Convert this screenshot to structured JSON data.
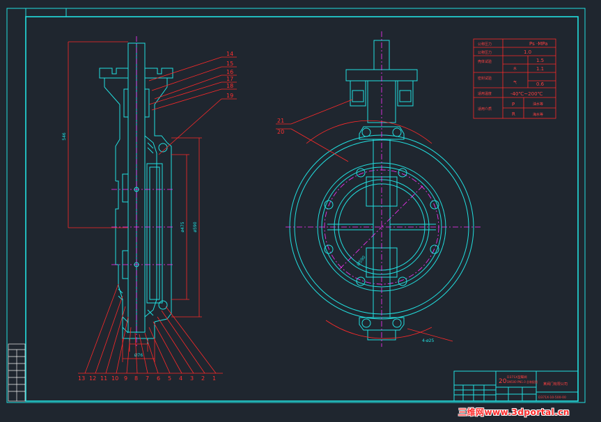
{
  "balloons_left_top": [
    "14",
    "15",
    "16",
    "17",
    "18",
    "19"
  ],
  "balloons_bottom": [
    "13",
    "12",
    "11",
    "10",
    "9",
    "8",
    "7",
    "6",
    "5",
    "4",
    "3",
    "2",
    "1"
  ],
  "balloons_right": [
    "21",
    "20"
  ],
  "dimension_labels": {
    "overall_height": "546",
    "body_inner": "ø475",
    "body_outer": "ø590",
    "body_width": "Ø76",
    "pcd": "Ø590",
    "bolt_holes": "4-ø25"
  },
  "spec_table": {
    "header_left": "公称压力",
    "header_right": "Ps ·MPa",
    "row_nominal": "1.0",
    "test_shell": "1.5",
    "test_seal_water": "1.1",
    "test_seal_air": "0.6",
    "water_label": "水",
    "air_label": "气",
    "temperature": "-40℃~200℃",
    "media_p": "P",
    "media_r": "R",
    "label_a": "公称压力",
    "label_b": "壳体试验",
    "label_c": "密封试验",
    "label_d": "适用温度",
    "label_e": "适用介质",
    "media_p_text": "油水等",
    "media_r_text": "海水等"
  },
  "title_block": {
    "scale": "20",
    "name_line1": "D371X型蝶阀",
    "name_line2": "DN500 PN1.0 总装配图",
    "company": "某阀门有限公司",
    "drawing_no": "D371X-10-500-00"
  },
  "watermark": "三维网www.3dportal.cn"
}
